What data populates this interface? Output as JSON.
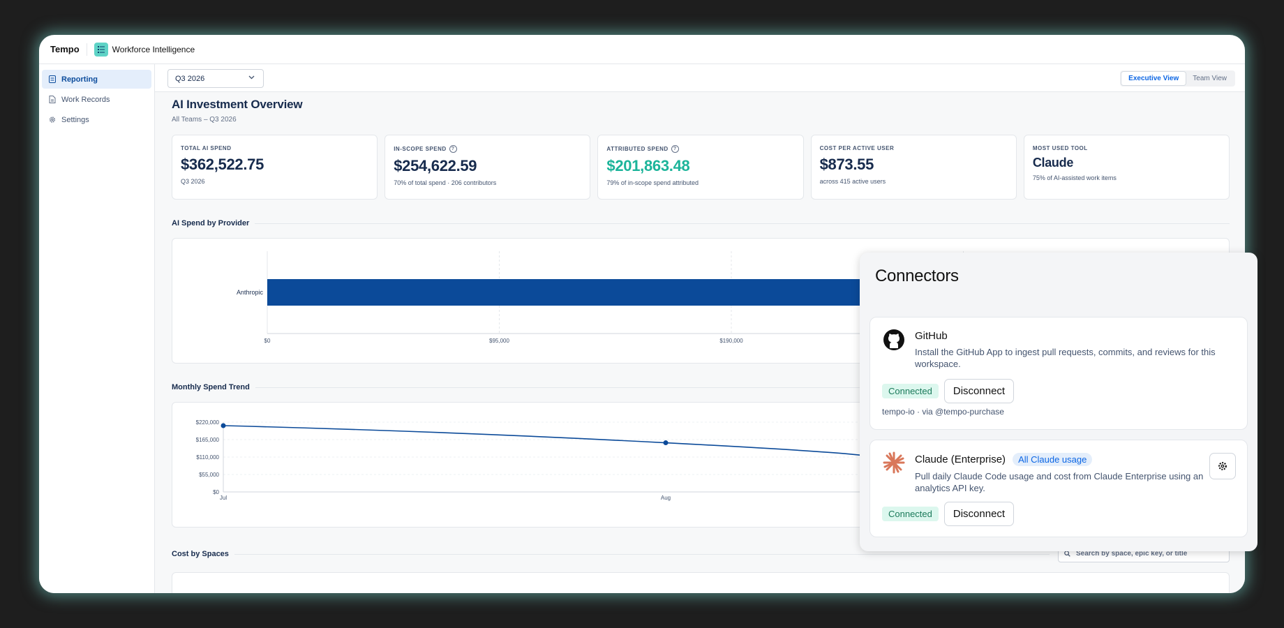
{
  "topbar": {
    "brand": "Tempo",
    "app_title": "Workforce Intelligence"
  },
  "sidebar": {
    "items": [
      {
        "label": "Reporting",
        "icon": "report-icon",
        "active": true
      },
      {
        "label": "Work Records",
        "icon": "document-icon",
        "active": false
      },
      {
        "label": "Settings",
        "icon": "gear-icon",
        "active": false
      }
    ]
  },
  "toolbar": {
    "period": "Q3 2026",
    "views": [
      "Executive View",
      "Team View"
    ],
    "active_view": "Executive View"
  },
  "page": {
    "title": "AI Investment Overview",
    "subtitle": "All Teams – Q3 2026"
  },
  "kpis": [
    {
      "label": "TOTAL AI SPEND",
      "value": "$362,522.75",
      "note": "Q3 2026"
    },
    {
      "label": "IN-SCOPE SPEND",
      "value": "$254,622.59",
      "note": "70% of total spend · 206 contributors"
    },
    {
      "label": "ATTRIBUTED SPEND",
      "value": "$201,863.48",
      "note": "79% of in-scope spend attributed"
    },
    {
      "label": "COST PER ACTIVE USER",
      "value": "$873.55",
      "note": "across 415 active users"
    },
    {
      "label": "MOST USED TOOL",
      "value": "Claude",
      "note": "75% of AI-assisted work items"
    }
  ],
  "sections": {
    "provider": "AI Spend by Provider",
    "trend": "Monthly Spend Trend",
    "spaces": "Cost by Spaces"
  },
  "search": {
    "placeholder": "Search by space, epic key, or title"
  },
  "chart_data": [
    {
      "type": "bar",
      "orientation": "horizontal",
      "title": "AI Spend by Provider",
      "categories": [
        "Anthropic"
      ],
      "values": [
        362522.75
      ],
      "x_ticks": [
        "$0",
        "$95,000",
        "$190,000"
      ],
      "xlim": [
        0,
        380000
      ],
      "color": "#0b4a99",
      "grid": true
    },
    {
      "type": "line",
      "title": "Monthly Spend Trend",
      "x": [
        "Jul",
        "Aug"
      ],
      "y_ticks": [
        "$0",
        "$55,000",
        "$110,000",
        "$165,000",
        "$220,000"
      ],
      "ylim": [
        0,
        220000
      ],
      "series": [
        {
          "values": [
            209000,
            155000
          ]
        }
      ],
      "color": "#0b4a99",
      "grid": true
    }
  ],
  "connectors": {
    "title": "Connectors",
    "items": [
      {
        "name": "GitHub",
        "icon": "github-icon",
        "description": "Install the GitHub App to ingest pull requests, commits, and reviews for this workspace.",
        "status": "Connected",
        "action": "Disconnect",
        "meta": "tempo-io · via @tempo-purchase"
      },
      {
        "name": "Claude (Enterprise)",
        "icon": "claude-icon",
        "badge": "All Claude usage",
        "description": "Pull daily Claude Code usage and cost from Claude Enterprise using an analytics API key.",
        "status": "Connected",
        "action": "Disconnect"
      }
    ]
  }
}
